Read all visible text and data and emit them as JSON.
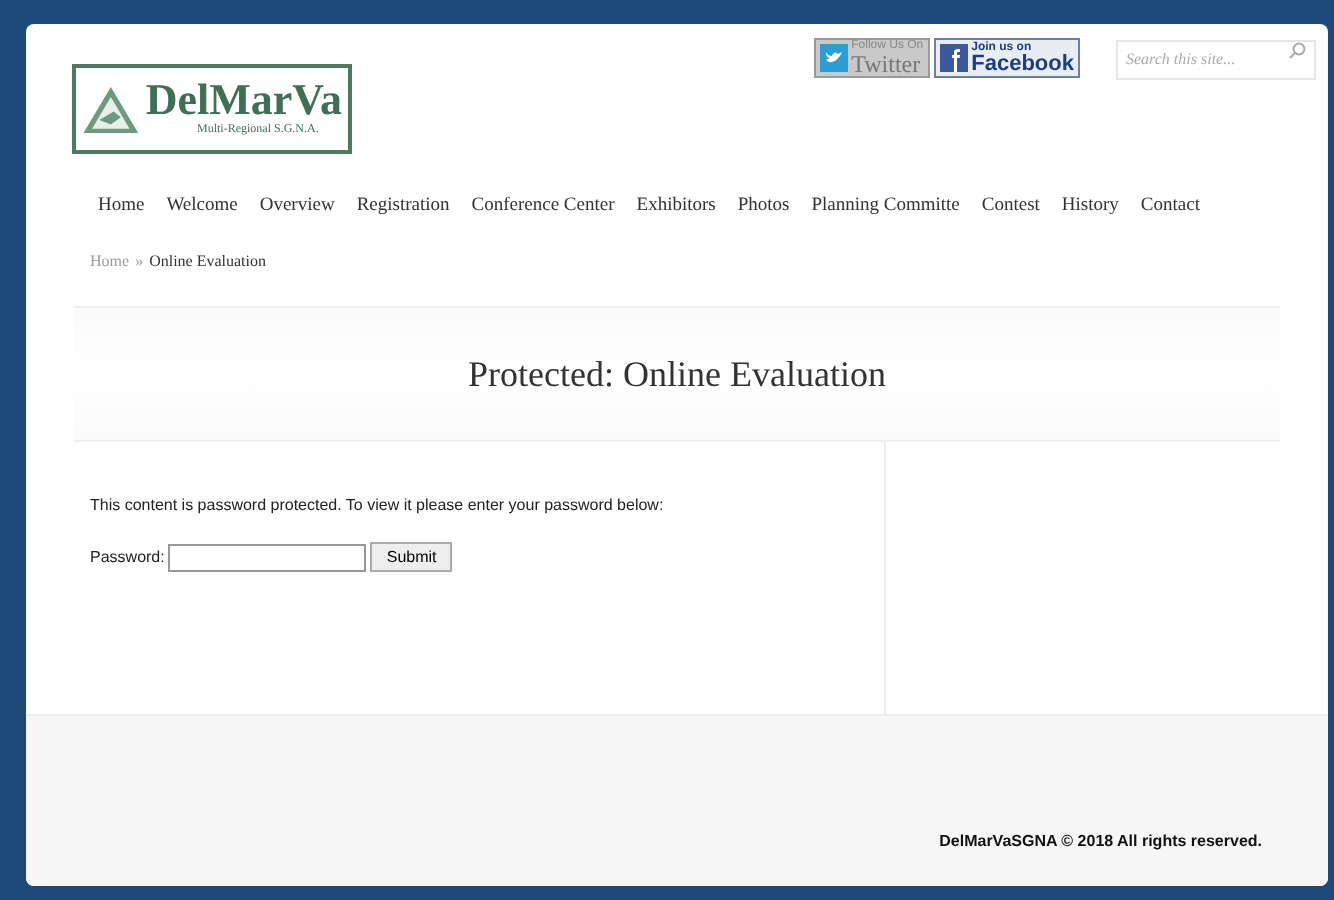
{
  "header": {
    "logo": {
      "name": "DelMarVa",
      "subtitle": "Multi-Regional S.G.N.A."
    },
    "social": [
      {
        "kind": "twitter",
        "small": "Follow Us On",
        "big": "Twitter"
      },
      {
        "kind": "facebook",
        "small": "Join us on",
        "big": "Facebook"
      }
    ],
    "search": {
      "placeholder": "Search this site..."
    }
  },
  "nav": [
    "Home",
    "Welcome",
    "Overview",
    "Registration",
    "Conference Center",
    "Exhibitors",
    "Photos",
    "Planning Committe",
    "Contest",
    "History",
    "Contact"
  ],
  "breadcrumb": {
    "link": "Home",
    "separator": "»",
    "current": "Online Evaluation"
  },
  "page_title": "Protected: Online Evaluation",
  "content": {
    "message": "This content is password protected. To view it please enter your password below:",
    "password_label": "Password:",
    "submit": "Submit"
  },
  "footer": "DelMarVaSGNA © 2018 All rights reserved."
}
